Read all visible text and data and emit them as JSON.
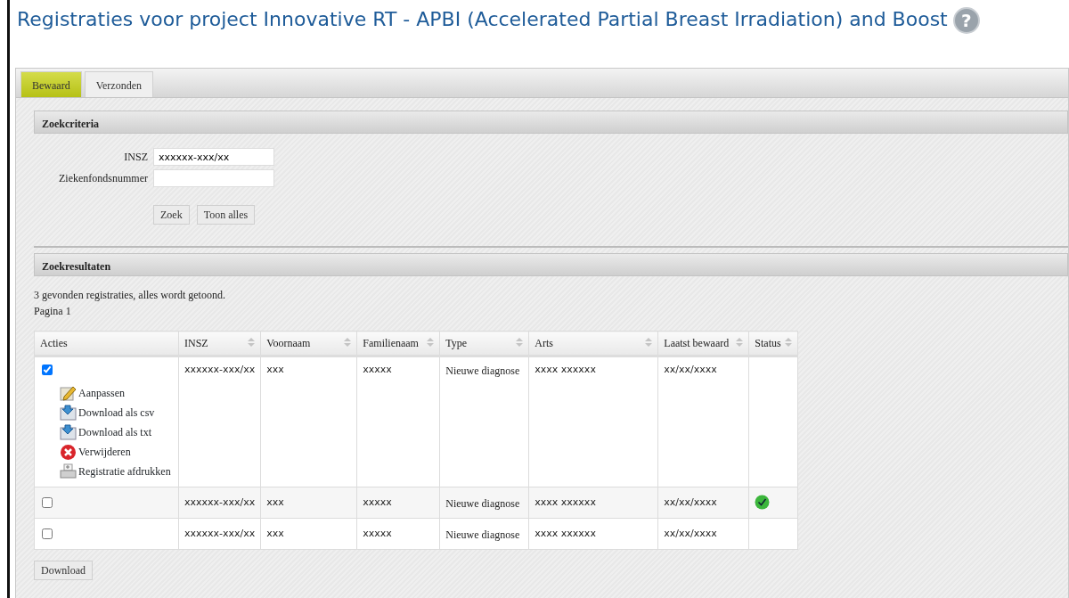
{
  "title": "Registraties voor project Innovative RT - APBI (Accelerated Partial Breast Irradiation) and Boost",
  "help": "?",
  "tabs": [
    {
      "label": "Bewaard",
      "selected": true
    },
    {
      "label": "Verzonden",
      "selected": false
    }
  ],
  "search": {
    "title": "Zoekcriteria",
    "fields": [
      {
        "label": "INSZ",
        "value": "xxxxxx-xxx/xx"
      },
      {
        "label": "Ziekenfondsnummer"
      }
    ],
    "buttons": [
      "Zoek",
      "Toon alles"
    ]
  },
  "results": {
    "title": "Zoekresultaten",
    "summary": "3 gevonden registraties, alles wordt getoond.",
    "page": "Pagina 1",
    "columns": [
      {
        "label": "Acties",
        "sortable": false
      },
      {
        "label": "INSZ",
        "sortable": true
      },
      {
        "label": "Voornaam",
        "sortable": true
      },
      {
        "label": "Familienaam",
        "sortable": true
      },
      {
        "label": "Type",
        "sortable": true
      },
      {
        "label": "Arts",
        "sortable": true
      },
      {
        "label": "Laatst bewaard",
        "sortable": true
      },
      {
        "label": "Status",
        "sortable": true
      }
    ],
    "rows": [
      {
        "selected": true,
        "actions": [
          {
            "kind": "edit",
            "label": "Aanpassen"
          },
          {
            "kind": "download",
            "label": "Download als csv"
          },
          {
            "kind": "download",
            "label": "Download als txt"
          },
          {
            "kind": "delete",
            "label": "Verwijderen"
          },
          {
            "kind": "print",
            "label": "Registratie afdrukken"
          }
        ],
        "insz": "xxxxxx-xxx/xx",
        "voornaam": "xxx",
        "familienaam": "xxxxx",
        "type": "Nieuwe diagnose",
        "arts": "xxxx xxxxxx",
        "laatst_bewaard": "xx/xx/xxxx",
        "status_ok": false
      },
      {
        "selected": false,
        "insz": "xxxxxx-xxx/xx",
        "voornaam": "xxx",
        "familienaam": "xxxxx",
        "type": "Nieuwe diagnose",
        "arts": "xxxx xxxxxx",
        "laatst_bewaard": "xx/xx/xxxx",
        "status_ok": true
      },
      {
        "selected": false,
        "insz": "xxxxxx-xxx/xx",
        "voornaam": "xxx",
        "familienaam": "xxxxx",
        "type": "Nieuwe diagnose",
        "arts": "xxxx xxxxxx",
        "laatst_bewaard": "xx/xx/xxxx",
        "status_ok": false
      }
    ],
    "download": "Download"
  }
}
